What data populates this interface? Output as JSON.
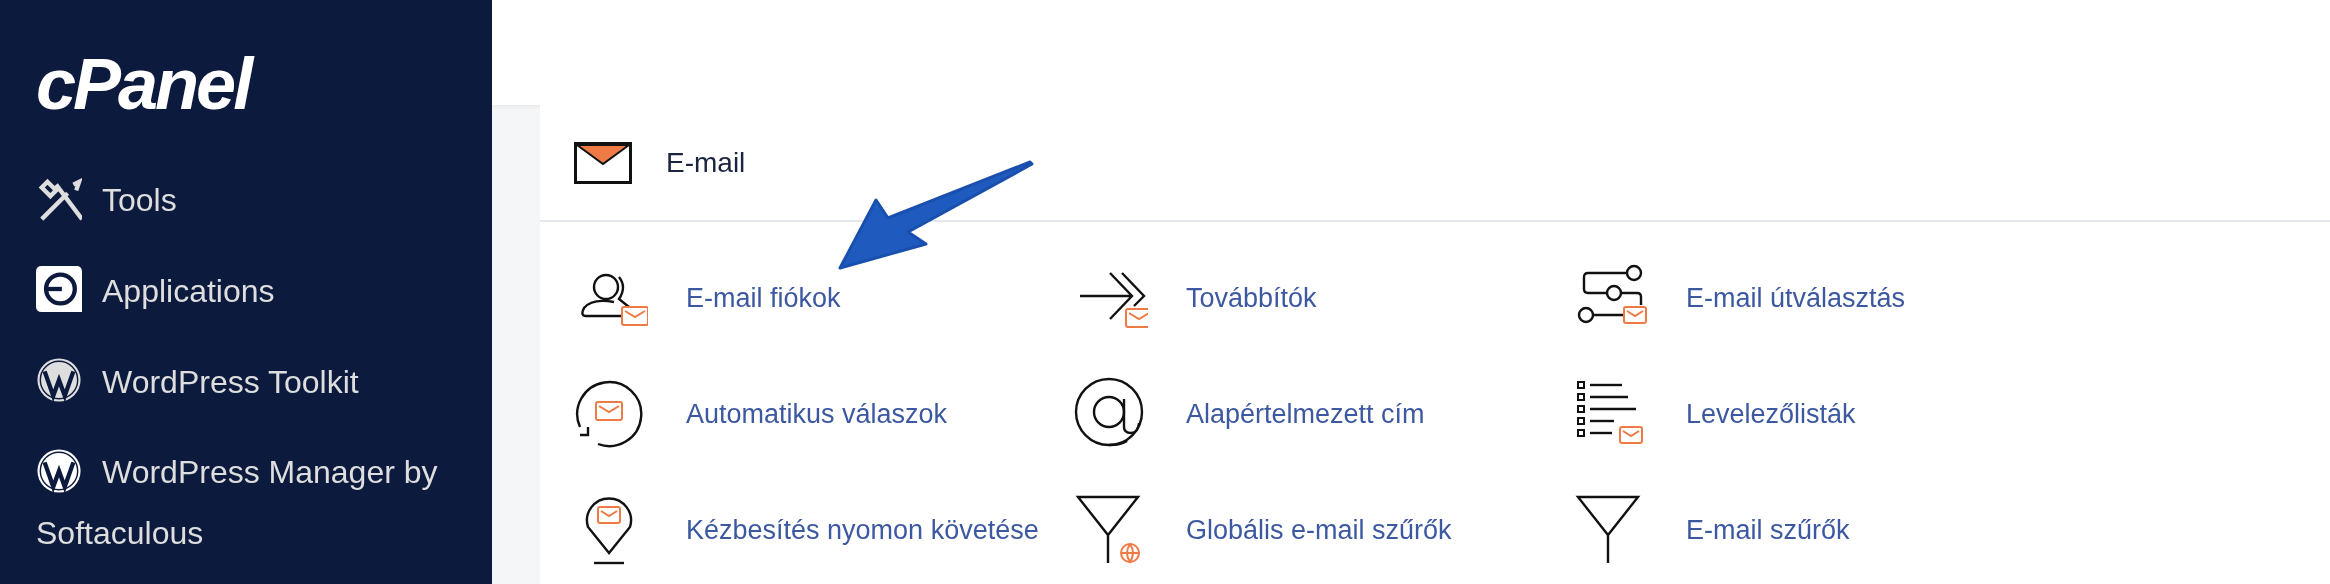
{
  "sidebar": {
    "logo": "cPanel",
    "items": [
      {
        "label": "Tools"
      },
      {
        "label": "Applications"
      },
      {
        "label": "WordPress Toolkit"
      },
      {
        "label": "WordPress Manager by Softaculous"
      }
    ]
  },
  "panel": {
    "title": "E-mail",
    "items": [
      {
        "label": "E-mail fiókok"
      },
      {
        "label": "Továbbítók"
      },
      {
        "label": "E-mail útválasztás"
      },
      {
        "label": "Automatikus válaszok"
      },
      {
        "label": "Alapértelmezett cím"
      },
      {
        "label": "Levelezőlisták"
      },
      {
        "label": "Kézbesítés nyomon követése"
      },
      {
        "label": "Globális e-mail szűrők"
      },
      {
        "label": "E-mail szűrők"
      }
    ]
  }
}
